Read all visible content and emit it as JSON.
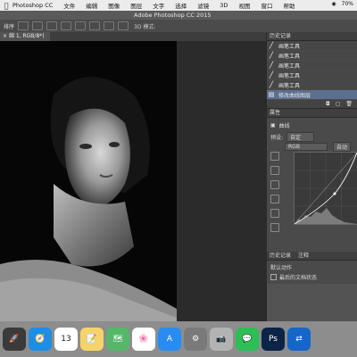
{
  "menubar": {
    "items": [
      "Photoshop CC",
      "文件",
      "编辑",
      "图像",
      "图层",
      "文字",
      "选择",
      "滤镜",
      "3D",
      "视图",
      "窗口",
      "帮助"
    ],
    "battery": "70%"
  },
  "window_title": "Adobe Photoshop CC 2015",
  "document_tab": "绵 1, RGB/8*)",
  "tool_options": {
    "label": "排序",
    "mode_3d": "3D 模式:"
  },
  "history": {
    "title": "历史记录",
    "items": [
      "画笔工具",
      "画笔工具",
      "画笔工具",
      "画笔工具",
      "画笔工具",
      "修改曲线图层"
    ]
  },
  "properties": {
    "title": "属性",
    "subtitle": "曲线",
    "preset_label": "预设:",
    "preset_value": "自定",
    "channel": "RGB",
    "auto_label": "自动"
  },
  "actions": {
    "tabs": [
      "历史记录",
      "注释"
    ],
    "item": "默认动作",
    "checkbox_label": "最后的文档状态"
  },
  "dock": [
    {
      "name": "rocket",
      "glyph": "🚀",
      "color": "#3a3a3a"
    },
    {
      "name": "safari",
      "glyph": "🧭",
      "color": "#1c8ee6"
    },
    {
      "name": "calendar",
      "glyph": "13",
      "color": "#ffffff"
    },
    {
      "name": "notes",
      "glyph": "📝",
      "color": "#f5d36b"
    },
    {
      "name": "maps",
      "glyph": "🗺",
      "color": "#56b76a"
    },
    {
      "name": "photos",
      "glyph": "🌸",
      "color": "#ffffff"
    },
    {
      "name": "appstore",
      "glyph": "A",
      "color": "#2a8cf0"
    },
    {
      "name": "system-preferences",
      "glyph": "⚙",
      "color": "#7a7a7a"
    },
    {
      "name": "photo-booth",
      "glyph": "📷",
      "color": "#b3b3b3"
    },
    {
      "name": "wechat",
      "glyph": "💬",
      "color": "#2dbe55"
    },
    {
      "name": "photoshop",
      "glyph": "Ps",
      "color": "#0c2445"
    },
    {
      "name": "teamviewer",
      "glyph": "⇄",
      "color": "#1666c8"
    }
  ]
}
